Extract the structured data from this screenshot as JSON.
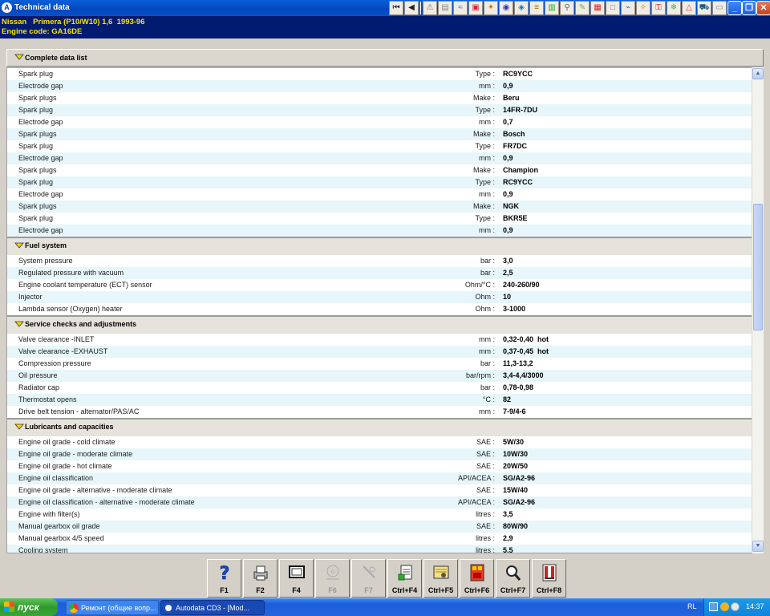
{
  "window": {
    "title": "Technical data",
    "vehicle_line": "Nissan   Primera (P10/W10) 1,6  1993-96",
    "engine_line": "Engine code: GA16DE"
  },
  "top_section": {
    "title": "Complete data list"
  },
  "list": [
    {
      "kind": "row",
      "name": "Spark plug",
      "unit": "Type :",
      "value": "RC9YCC"
    },
    {
      "kind": "row",
      "name": "Electrode gap",
      "unit": "mm :",
      "value": "0,9"
    },
    {
      "kind": "row",
      "name": "Spark plugs",
      "unit": "Make :",
      "value": "Beru"
    },
    {
      "kind": "row",
      "name": "Spark plug",
      "unit": "Type :",
      "value": "14FR-7DU"
    },
    {
      "kind": "row",
      "name": "Electrode gap",
      "unit": "mm :",
      "value": "0,7"
    },
    {
      "kind": "row",
      "name": "Spark plugs",
      "unit": "Make :",
      "value": "Bosch"
    },
    {
      "kind": "row",
      "name": "Spark plug",
      "unit": "Type :",
      "value": "FR7DC"
    },
    {
      "kind": "row",
      "name": "Electrode gap",
      "unit": "mm :",
      "value": "0,9"
    },
    {
      "kind": "row",
      "name": "Spark plugs",
      "unit": "Make :",
      "value": "Champion"
    },
    {
      "kind": "row",
      "name": "Spark plug",
      "unit": "Type :",
      "value": "RC9YCC"
    },
    {
      "kind": "row",
      "name": "Electrode gap",
      "unit": "mm :",
      "value": "0,9"
    },
    {
      "kind": "row",
      "name": "Spark plugs",
      "unit": "Make :",
      "value": "NGK"
    },
    {
      "kind": "row",
      "name": "Spark plug",
      "unit": "Type :",
      "value": "BKR5E"
    },
    {
      "kind": "row",
      "name": "Electrode gap",
      "unit": "mm :",
      "value": "0,9"
    },
    {
      "kind": "section",
      "title": "Fuel system"
    },
    {
      "kind": "row",
      "name": "System pressure",
      "unit": "bar :",
      "value": "3,0"
    },
    {
      "kind": "row",
      "name": "Regulated pressure with vacuum",
      "unit": "bar :",
      "value": "2,5"
    },
    {
      "kind": "row",
      "name": "Engine coolant temperature (ECT) sensor",
      "unit": "Ohm/°C :",
      "value": "240-260/90"
    },
    {
      "kind": "row",
      "name": "Injector",
      "unit": "Ohm :",
      "value": "10"
    },
    {
      "kind": "row",
      "name": "Lambda sensor (Oxygen) heater",
      "unit": "Ohm :",
      "value": "3-1000"
    },
    {
      "kind": "section",
      "title": "Service checks and adjustments"
    },
    {
      "kind": "row",
      "name": "Valve clearance  -INLET",
      "unit": "mm :",
      "value": "0,32-0,40  hot"
    },
    {
      "kind": "row",
      "name": "Valve clearance  -EXHAUST",
      "unit": "mm :",
      "value": "0,37-0,45  hot"
    },
    {
      "kind": "row",
      "name": "Compression pressure",
      "unit": "bar :",
      "value": "11,3-13,2"
    },
    {
      "kind": "row",
      "name": "Oil pressure",
      "unit": "bar/rpm :",
      "value": "3,4-4,4/3000"
    },
    {
      "kind": "row",
      "name": "Radiator cap",
      "unit": "bar :",
      "value": "0,78-0,98"
    },
    {
      "kind": "row",
      "name": "Thermostat opens",
      "unit": "°C :",
      "value": "82"
    },
    {
      "kind": "row",
      "name": "Drive belt tension - alternator/PAS/AC",
      "unit": "mm :",
      "value": "7-9/4-6"
    },
    {
      "kind": "section",
      "title": "Lubricants and capacities"
    },
    {
      "kind": "row",
      "name": "Engine oil grade - cold climate",
      "unit": "SAE :",
      "value": "5W/30"
    },
    {
      "kind": "row",
      "name": "Engine oil grade - moderate climate",
      "unit": "SAE :",
      "value": "10W/30"
    },
    {
      "kind": "row",
      "name": "Engine oil grade - hot climate",
      "unit": "SAE :",
      "value": "20W/50"
    },
    {
      "kind": "row",
      "name": "Engine oil classification",
      "unit": "API/ACEA :",
      "value": "SG/A2-96"
    },
    {
      "kind": "row",
      "name": "Engine oil grade - alternative - moderate climate",
      "unit": "SAE :",
      "value": "15W/40"
    },
    {
      "kind": "row",
      "name": "Engine oil classification - alternative - moderate climate",
      "unit": "API/ACEA :",
      "value": "SG/A2-96"
    },
    {
      "kind": "row",
      "name": "Engine with filter(s)",
      "unit": "litres :",
      "value": "3,5"
    },
    {
      "kind": "row",
      "name": "Manual gearbox oil grade",
      "unit": "SAE :",
      "value": "80W/90"
    },
    {
      "kind": "row",
      "name": "Manual gearbox 4/5 speed",
      "unit": "litres :",
      "value": "2,9"
    },
    {
      "kind": "row",
      "name": "Cooling system",
      "unit": "litres :",
      "value": "5,5"
    }
  ],
  "fkeys": [
    {
      "label": "F1",
      "icon": "help-icon",
      "enabled": true
    },
    {
      "label": "F2",
      "icon": "print-icon",
      "enabled": true
    },
    {
      "label": "F4",
      "icon": "monitor-icon",
      "enabled": true
    },
    {
      "label": "F6",
      "icon": "diagram-icon",
      "enabled": false
    },
    {
      "label": "F7",
      "icon": "tools-icon",
      "enabled": false
    },
    {
      "label": "Ctrl+F4",
      "icon": "notes-icon",
      "enabled": true
    },
    {
      "label": "Ctrl+F5",
      "icon": "data-card-icon",
      "enabled": true
    },
    {
      "label": "Ctrl+F6",
      "icon": "calculator-icon",
      "enabled": true
    },
    {
      "label": "Ctrl+F7",
      "icon": "search-icon",
      "enabled": true
    },
    {
      "label": "Ctrl+F8",
      "icon": "exit-icon",
      "enabled": true
    }
  ],
  "taskbar": {
    "start_label": "пуск",
    "tasks": [
      {
        "label": "Ремонт (общие вопр...",
        "icon": "browser-icon"
      },
      {
        "label": "Autodata CD3 - [Mod...",
        "icon": "autodata-icon"
      }
    ],
    "lang": "RL",
    "time": "14:37"
  },
  "colors": {
    "info_bg": "#001b70",
    "info_fg": "#f7e300",
    "row_alt": "#e6f6fb",
    "diamond": "#f5d800"
  }
}
